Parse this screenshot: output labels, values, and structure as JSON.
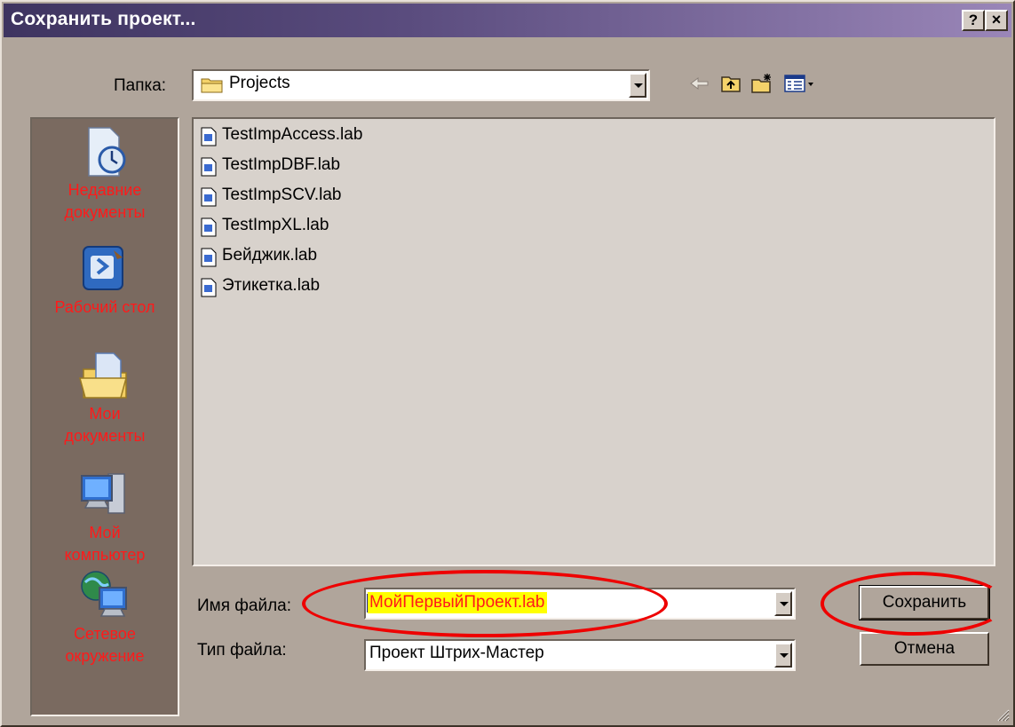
{
  "window": {
    "title": "Сохранить проект...",
    "help_button": "?",
    "close_button": "×"
  },
  "folder": {
    "label": "Папка:",
    "value": "Projects"
  },
  "toolbar": {
    "back_icon": "arrow-left-icon",
    "up_icon": "folder-up-icon",
    "new_folder_icon": "new-folder-icon",
    "view_menu_icon": "view-menu-icon"
  },
  "places": [
    {
      "icon": "recent-documents-icon",
      "label_1": "Недавние",
      "label_2": "документы"
    },
    {
      "icon": "desktop-icon",
      "label_1": "Рабочий стол",
      "label_2": ""
    },
    {
      "icon": "my-documents-icon",
      "label_1": "Мои",
      "label_2": "документы"
    },
    {
      "icon": "my-computer-icon",
      "label_1": "Мой",
      "label_2": "компьютер"
    },
    {
      "icon": "network-icon",
      "label_1": "Сетевое",
      "label_2": "окружение"
    }
  ],
  "files": [
    {
      "name": "TestImpAccess.lab"
    },
    {
      "name": "TestImpDBF.lab"
    },
    {
      "name": "TestImpSCV.lab"
    },
    {
      "name": "TestImpXL.lab"
    },
    {
      "name": "Бейджик.lab"
    },
    {
      "name": "Этикетка.lab"
    }
  ],
  "filename": {
    "label": "Имя файла:",
    "value": "МойПервыйПроект.lab"
  },
  "filetype": {
    "label": "Тип файла:",
    "value": "Проект Штрих-Мастер"
  },
  "buttons": {
    "save": "Сохранить",
    "cancel": "Отмена"
  },
  "colors": {
    "annotation": "#ee0000",
    "place_label": "#ff1a1a",
    "filename_highlight": "#ffff00"
  }
}
